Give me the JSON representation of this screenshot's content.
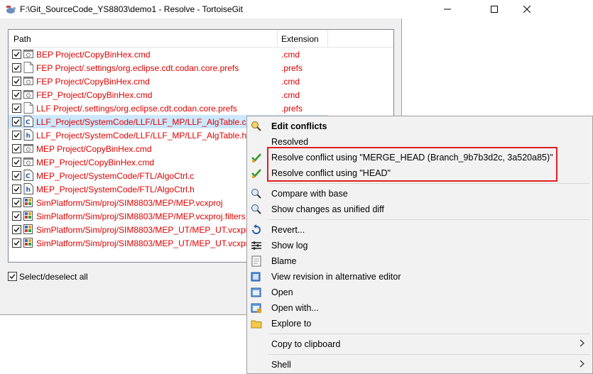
{
  "window": {
    "title": "F:\\Git_SourceCode_YS8803\\demo1 - Resolve - TortoiseGit"
  },
  "columns": {
    "path": "Path",
    "extension": "Extension"
  },
  "files": [
    {
      "path": "BEP Project/CopyBinHex.cmd",
      "ext": ".cmd",
      "icon": "cmd-icon",
      "checked": true,
      "selected": false
    },
    {
      "path": "FEP Project/.settings/org.eclipse.cdt.codan.core.prefs",
      "ext": ".prefs",
      "icon": "file-icon",
      "checked": true,
      "selected": false
    },
    {
      "path": "FEP Project/CopyBinHex.cmd",
      "ext": ".cmd",
      "icon": "cmd-icon",
      "checked": true,
      "selected": false
    },
    {
      "path": "FEP_Project/CopyBinHex.cmd",
      "ext": ".cmd",
      "icon": "cmd-icon",
      "checked": true,
      "selected": false
    },
    {
      "path": "LLF Project/.settings/org.eclipse.cdt.codan.core.prefs",
      "ext": ".prefs",
      "icon": "file-icon",
      "checked": true,
      "selected": false
    },
    {
      "path": "LLF_Project/SystemCode/LLF/LLF_MP/LLF_AlgTable.c",
      "ext": "",
      "icon": "c-source-icon",
      "checked": true,
      "selected": true
    },
    {
      "path": "LLF_Project/SystemCode/LLF/LLF_MP/LLF_AlgTable.h",
      "ext": "",
      "icon": "h-header-icon",
      "checked": true,
      "selected": false
    },
    {
      "path": "MEP Project/CopyBinHex.cmd",
      "ext": "",
      "icon": "cmd-icon",
      "checked": true,
      "selected": false
    },
    {
      "path": "MEP_Project/CopyBinHex.cmd",
      "ext": "",
      "icon": "cmd-icon",
      "checked": true,
      "selected": false
    },
    {
      "path": "MEP_Project/SystemCode/FTL/AlgoCtrl.c",
      "ext": "",
      "icon": "c-source-icon",
      "checked": true,
      "selected": false
    },
    {
      "path": "MEP_Project/SystemCode/FTL/AlgoCtrl.h",
      "ext": "",
      "icon": "h-header-icon",
      "checked": true,
      "selected": false
    },
    {
      "path": "SimPlatform/Sim/proj/SIM8803/MEP/MEP.vcxproj",
      "ext": "",
      "icon": "vcxproj-icon",
      "checked": true,
      "selected": false
    },
    {
      "path": "SimPlatform/Sim/proj/SIM8803/MEP/MEP.vcxproj.filters",
      "ext": "",
      "icon": "vcxproj-icon",
      "checked": true,
      "selected": false
    },
    {
      "path": "SimPlatform/Sim/proj/SIM8803/MEP_UT/MEP_UT.vcxpro",
      "ext": "",
      "icon": "vcxproj-icon",
      "checked": true,
      "selected": false
    },
    {
      "path": "SimPlatform/Sim/proj/SIM8803/MEP_UT/MEP_UT.vcxpro",
      "ext": "",
      "icon": "vcxproj-icon",
      "checked": true,
      "selected": false
    }
  ],
  "select_all_label": "Select/deselect all",
  "context_menu": [
    {
      "label": "Edit conflicts",
      "icon": "edit-conflicts-icon",
      "bold": true
    },
    {
      "label": "Resolved",
      "icon": "",
      "bold": false
    },
    {
      "label": "Resolve conflict using \"MERGE_HEAD (Branch_9b7b3d2c, 3a520a85)\"",
      "icon": "green-check-icon",
      "bold": false
    },
    {
      "label": "Resolve conflict using \"HEAD\"",
      "icon": "green-check-icon",
      "bold": false
    },
    {
      "separator": true
    },
    {
      "label": "Compare with base",
      "icon": "magnifier-icon",
      "bold": false
    },
    {
      "label": "Show changes as unified diff",
      "icon": "magnifier-icon",
      "bold": false
    },
    {
      "separator": true
    },
    {
      "label": "Revert...",
      "icon": "revert-icon",
      "bold": false
    },
    {
      "label": "Show log",
      "icon": "log-icon",
      "bold": false
    },
    {
      "label": "Blame",
      "icon": "blame-icon",
      "bold": false
    },
    {
      "label": "View revision in alternative editor",
      "icon": "editor-icon",
      "bold": false
    },
    {
      "label": "Open",
      "icon": "open-icon",
      "bold": false
    },
    {
      "label": "Open with...",
      "icon": "open-with-icon",
      "bold": false
    },
    {
      "label": "Explore to",
      "icon": "folder-icon",
      "bold": false
    },
    {
      "separator": true
    },
    {
      "label": "Copy to clipboard",
      "icon": "",
      "bold": false,
      "submenu": true
    },
    {
      "separator": true
    },
    {
      "label": "Shell",
      "icon": "",
      "bold": false,
      "submenu": true
    }
  ],
  "colors": {
    "conflict_text": "#e00000",
    "highlight_box": "#e02020",
    "selection": "#cce8ff"
  }
}
